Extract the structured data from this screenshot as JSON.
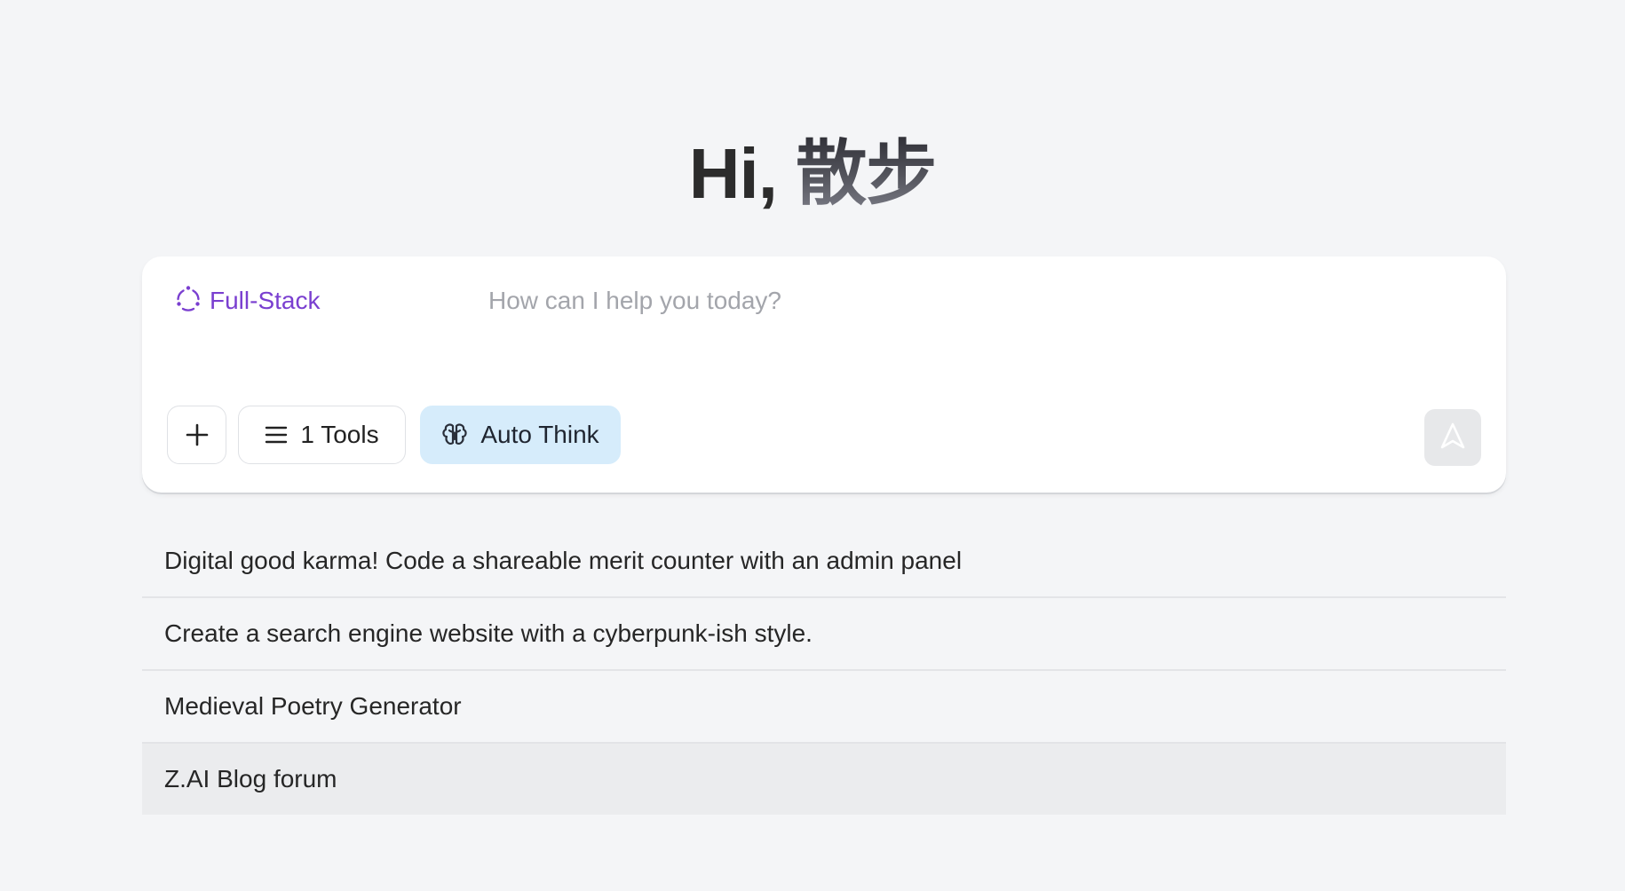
{
  "greeting": {
    "prefix": "Hi,",
    "name": "散步"
  },
  "composer": {
    "mode_label": "Full-Stack",
    "mode_icon": "full-stack-icon",
    "input_placeholder": "How can I help you today?",
    "input_value": "",
    "add_icon": "plus-icon",
    "tools_label": "1 Tools",
    "tools_icon": "menu-icon",
    "auto_think_label": "Auto Think",
    "auto_think_icon": "brain-icon",
    "send_icon": "send-arrow-icon",
    "colors": {
      "mode_accent": "#7a3fd0",
      "auto_think_bg": "#d6ecfb",
      "send_disabled_bg": "#e7e8ea"
    }
  },
  "suggestions": [
    {
      "label": "Digital good karma! Code a shareable merit counter with an admin panel"
    },
    {
      "label": "Create a search engine website with a cyberpunk-ish style."
    },
    {
      "label": "Medieval Poetry Generator"
    },
    {
      "label": "Z.AI Blog forum"
    }
  ]
}
